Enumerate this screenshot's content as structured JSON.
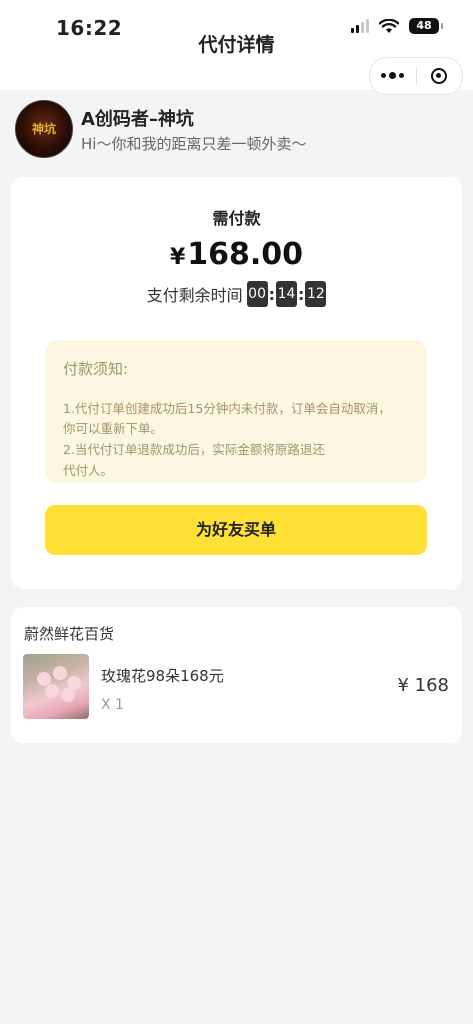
{
  "status_bar": {
    "time": "16:22",
    "battery": "48"
  },
  "header": {
    "title": "代付详情"
  },
  "profile": {
    "name": "A创码者–神坑",
    "slogan": "Hi～你和我的距离只差一顿外卖～",
    "avatar_text": "神坑"
  },
  "payment": {
    "need_label": "需付款",
    "currency": "¥",
    "amount": "168.00",
    "countdown_label": "支付剩余时间",
    "hours": "00",
    "minutes": "14",
    "seconds": "12"
  },
  "notice": {
    "title": "付款须知:",
    "lines": [
      "1.代付订单创建成功后15分钟内未付款，订单会自动取消，",
      "你可以重新下单。",
      "2.当代付订单退款成功后，实际金额将原路退还",
      "代付人。"
    ]
  },
  "buy_button": {
    "label": "为好友买单"
  },
  "order": {
    "shop_name": "蔚然鲜花百货",
    "item_name": "玫瑰花98朵168元",
    "quantity": "X 1",
    "price": "¥ 168"
  },
  "colors": {
    "accent": "#ffe135",
    "notice_bg": "#fdf7e2",
    "notice_text": "#a3936a",
    "background": "#f4f4f4"
  },
  "icons": [
    "signal-icon",
    "wifi-icon",
    "battery-icon",
    "more-dots-icon",
    "close-target-icon"
  ]
}
